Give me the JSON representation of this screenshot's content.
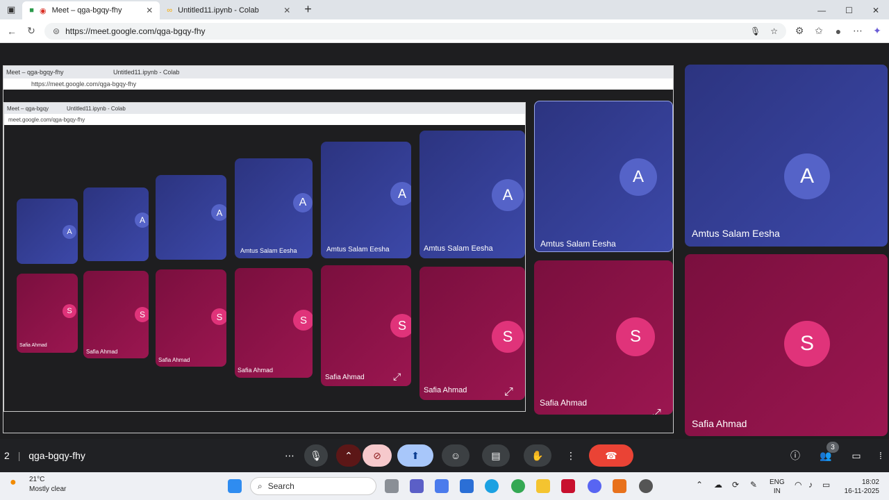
{
  "browser": {
    "tabs": [
      {
        "title": "Meet – qga-bgqy-fhy",
        "active": true
      },
      {
        "title": "Untitled11.ipynb - Colab",
        "active": false
      }
    ],
    "url": "https://meet.google.com/qga-bgqy-fhy"
  },
  "nested": {
    "tab1": "Meet – qga-bgqy-fhy",
    "tab2": "Untitled11.ipynb - Colab",
    "url": "https://meet.google.com/qga-bgqy-fhy",
    "url_short": "meet.google.com/qga-bgqy-fhy",
    "url_tiny": "qga-bgqy-fhy"
  },
  "participants": {
    "a": {
      "name": "Amtus Salam Eesha",
      "initial": "A"
    },
    "s": {
      "name": "Safia Ahmad",
      "initial": "S"
    }
  },
  "meeting": {
    "code": "qga-bgqy-fhy",
    "page_num": "2",
    "participant_count": "3"
  },
  "taskbar": {
    "temp": "21°C",
    "weather": "Mostly clear",
    "search_placeholder": "Search",
    "lang1": "ENG",
    "lang2": "IN",
    "time": "18:02",
    "date": "16-11-2025"
  },
  "colors": {
    "blue_tile": "#3c48a8",
    "magenta_tile": "#9b1650",
    "end_call": "#ea4335"
  }
}
